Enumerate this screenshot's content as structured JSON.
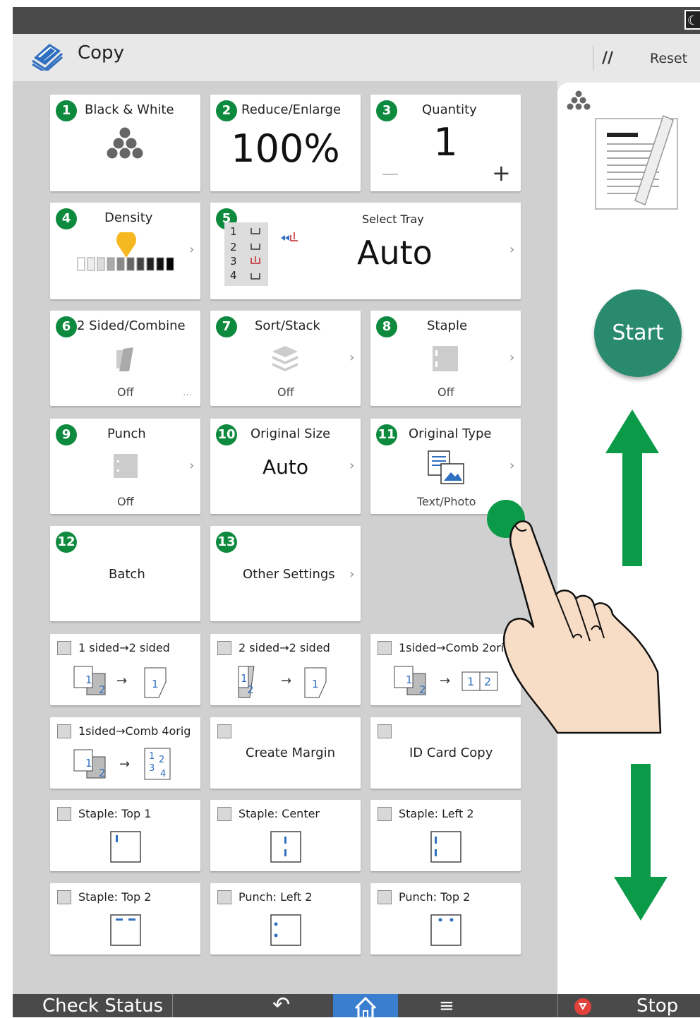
{
  "app": {
    "title": "Copy",
    "reset_label": "Reset"
  },
  "tiles": {
    "color": {
      "num": "1",
      "label": "Black & White"
    },
    "reduce": {
      "num": "2",
      "label": "Reduce/Enlarge",
      "value": "100%"
    },
    "quantity": {
      "num": "3",
      "label": "Quantity",
      "value": "1",
      "minus": "—",
      "plus": "+"
    },
    "density": {
      "num": "4",
      "label": "Density",
      "level": 0.5
    },
    "tray": {
      "num": "5",
      "label": "Select Tray",
      "value": "Auto",
      "trays": [
        "1",
        "2",
        "3",
        "4"
      ]
    },
    "duplex": {
      "num": "6",
      "label": "2 Sided/Combine",
      "value": "Off"
    },
    "sort": {
      "num": "7",
      "label": "Sort/Stack",
      "value": "Off"
    },
    "staple": {
      "num": "8",
      "label": "Staple",
      "value": "Off"
    },
    "punch": {
      "num": "9",
      "label": "Punch",
      "value": "Off"
    },
    "origsize": {
      "num": "10",
      "label": "Original Size",
      "value": "Auto"
    },
    "origtype": {
      "num": "11",
      "label": "Original Type",
      "value": "Text/Photo"
    },
    "batch": {
      "num": "12",
      "label": "Batch"
    },
    "other": {
      "num": "13",
      "label": "Other Settings"
    }
  },
  "shortcuts": [
    {
      "label": "1 sided→2 sided",
      "a": "1",
      "b": "2",
      "c": "1"
    },
    {
      "label": "2 sided→2 sided",
      "a": "1",
      "b": "2",
      "c": "1"
    },
    {
      "label": "1sided→Comb 2orig",
      "a": "1",
      "b": "2",
      "c1": "1",
      "c2": "2"
    },
    {
      "label": "1sided→Comb 4orig",
      "a": "1",
      "b": "2",
      "q1": "1",
      "q2": "2",
      "q3": "3",
      "q4": "4"
    },
    {
      "label": "Create Margin"
    },
    {
      "label": "ID Card Copy"
    },
    {
      "label": "Staple: Top 1"
    },
    {
      "label": "Staple: Center"
    },
    {
      "label": "Staple: Left 2"
    },
    {
      "label": "Staple: Top 2"
    },
    {
      "label": "Punch: Left 2"
    },
    {
      "label": "Punch: Top 2"
    }
  ],
  "start_label": "Start",
  "bottom": {
    "check_status": "Check Status",
    "stop": "Stop"
  },
  "colors": {
    "badge": "#0e8a3e",
    "start": "#2a8a6e",
    "arrow": "#0a9a48",
    "home": "#3a7fcf"
  }
}
